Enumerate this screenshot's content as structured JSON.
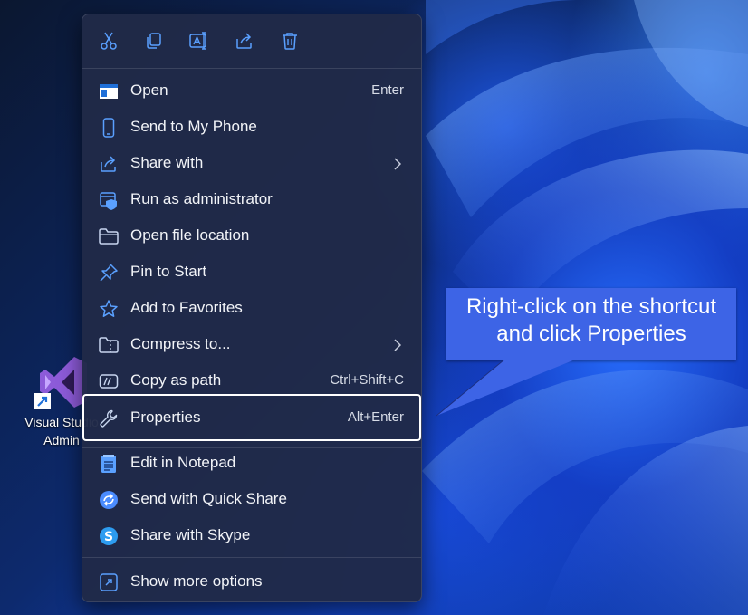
{
  "desktop": {
    "shortcut_label": "Visual Studio\nAdmin"
  },
  "context_menu": {
    "quick_actions": [
      {
        "name": "cut",
        "icon": "scissors-icon"
      },
      {
        "name": "copy",
        "icon": "copy-icon"
      },
      {
        "name": "rename",
        "icon": "rename-icon"
      },
      {
        "name": "share",
        "icon": "share-icon"
      },
      {
        "name": "delete",
        "icon": "trash-icon"
      }
    ],
    "items": [
      {
        "label": "Open",
        "shortcut": "Enter",
        "icon": "window-icon"
      },
      {
        "label": "Send to My Phone",
        "shortcut": "",
        "icon": "phone-icon"
      },
      {
        "label": "Share with",
        "shortcut": "",
        "icon": "share-icon",
        "submenu": true
      },
      {
        "label": "Run as administrator",
        "shortcut": "",
        "icon": "shield-icon"
      },
      {
        "label": "Open file location",
        "shortcut": "",
        "icon": "folder-icon"
      },
      {
        "label": "Pin to Start",
        "shortcut": "",
        "icon": "pin-icon"
      },
      {
        "label": "Add to Favorites",
        "shortcut": "",
        "icon": "star-icon"
      },
      {
        "label": "Compress to...",
        "shortcut": "",
        "icon": "zip-folder-icon",
        "submenu": true
      },
      {
        "label": "Copy as path",
        "shortcut": "Ctrl+Shift+C",
        "icon": "path-icon"
      },
      {
        "label": "Properties",
        "shortcut": "Alt+Enter",
        "icon": "wrench-icon",
        "highlighted": true
      },
      {
        "label": "Edit in Notepad",
        "shortcut": "",
        "icon": "notepad-icon"
      },
      {
        "label": "Send with Quick Share",
        "shortcut": "",
        "icon": "quick-share-icon"
      },
      {
        "label": "Share with Skype",
        "shortcut": "",
        "icon": "skype-icon"
      },
      {
        "label": "Show more options",
        "shortcut": "",
        "icon": "more-options-icon"
      }
    ]
  },
  "callout": {
    "text": "Right-click on the shortcut\nand click Properties"
  },
  "colors": {
    "menu_bg": "#202a48",
    "accent_blue": "#5aa0ff",
    "callout_bg": "#3d64e6",
    "highlight_border": "#ffffff"
  }
}
